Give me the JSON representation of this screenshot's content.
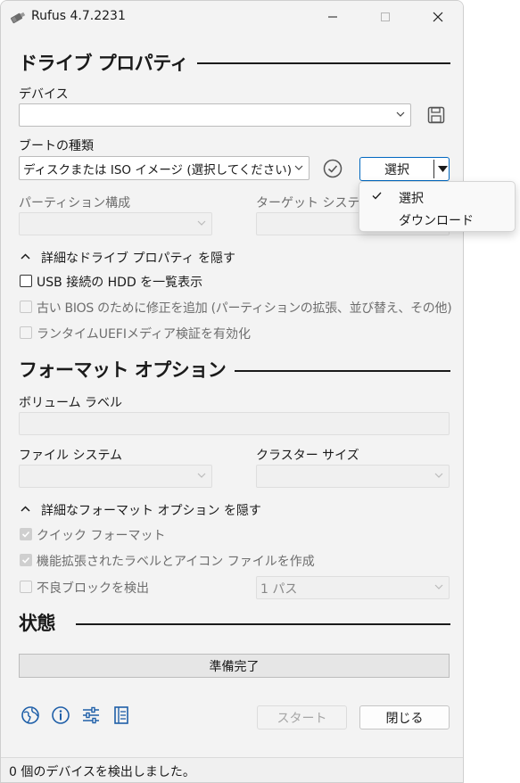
{
  "window": {
    "title": "Rufus 4.7.2231"
  },
  "drive_section": {
    "title": "ドライブ プロパティ",
    "device_label": "デバイス",
    "device_value": "",
    "boot_label": "ブートの種類",
    "boot_value": "ディスクまたは ISO イメージ (選択してください)",
    "select_button": "選択",
    "partition_label": "パーティション構成",
    "target_label": "ターゲット システム",
    "advanced_toggle": "詳細なドライブ プロパティ を隠す",
    "options": [
      {
        "label": "USB 接続の HDD を一覧表示",
        "checked": false,
        "enabled": true
      },
      {
        "label": "古い BIOS のために修正を追加 (パーティションの拡張、並び替え、その他)",
        "checked": false,
        "enabled": false
      },
      {
        "label": "ランタイムUEFIメディア検証を有効化",
        "checked": false,
        "enabled": false
      }
    ]
  },
  "format_section": {
    "title": "フォーマット オプション",
    "volume_label": "ボリューム ラベル",
    "filesystem_label": "ファイル システム",
    "cluster_label": "クラスター サイズ",
    "advanced_toggle": "詳細なフォーマット オプション を隠す",
    "options": [
      {
        "label": "クイック フォーマット",
        "checked": true,
        "enabled": false
      },
      {
        "label": "機能拡張されたラベルとアイコン ファイルを作成",
        "checked": true,
        "enabled": false
      },
      {
        "label": "不良ブロックを検出",
        "checked": false,
        "enabled": false
      }
    ],
    "passes_value": "1 パス"
  },
  "status_section": {
    "title": "状態",
    "progress_text": "準備完了",
    "progress": 0
  },
  "actions": {
    "start": "スタート",
    "close": "閉じる"
  },
  "statusbar": {
    "text": "0 個のデバイスを検出しました。"
  },
  "dropdown": {
    "items": [
      {
        "label": "選択",
        "checked": true
      },
      {
        "label": "ダウンロード",
        "checked": false
      }
    ]
  },
  "icons": {
    "app": "usb-drive-icon",
    "save": "floppy-save-icon",
    "verify": "check-circle-icon",
    "language": "globe-icon",
    "about": "info-icon",
    "settings": "sliders-icon",
    "log": "log-icon"
  },
  "colors": {
    "accent": "#0067c0",
    "window_bg": "#f3f3f3"
  }
}
